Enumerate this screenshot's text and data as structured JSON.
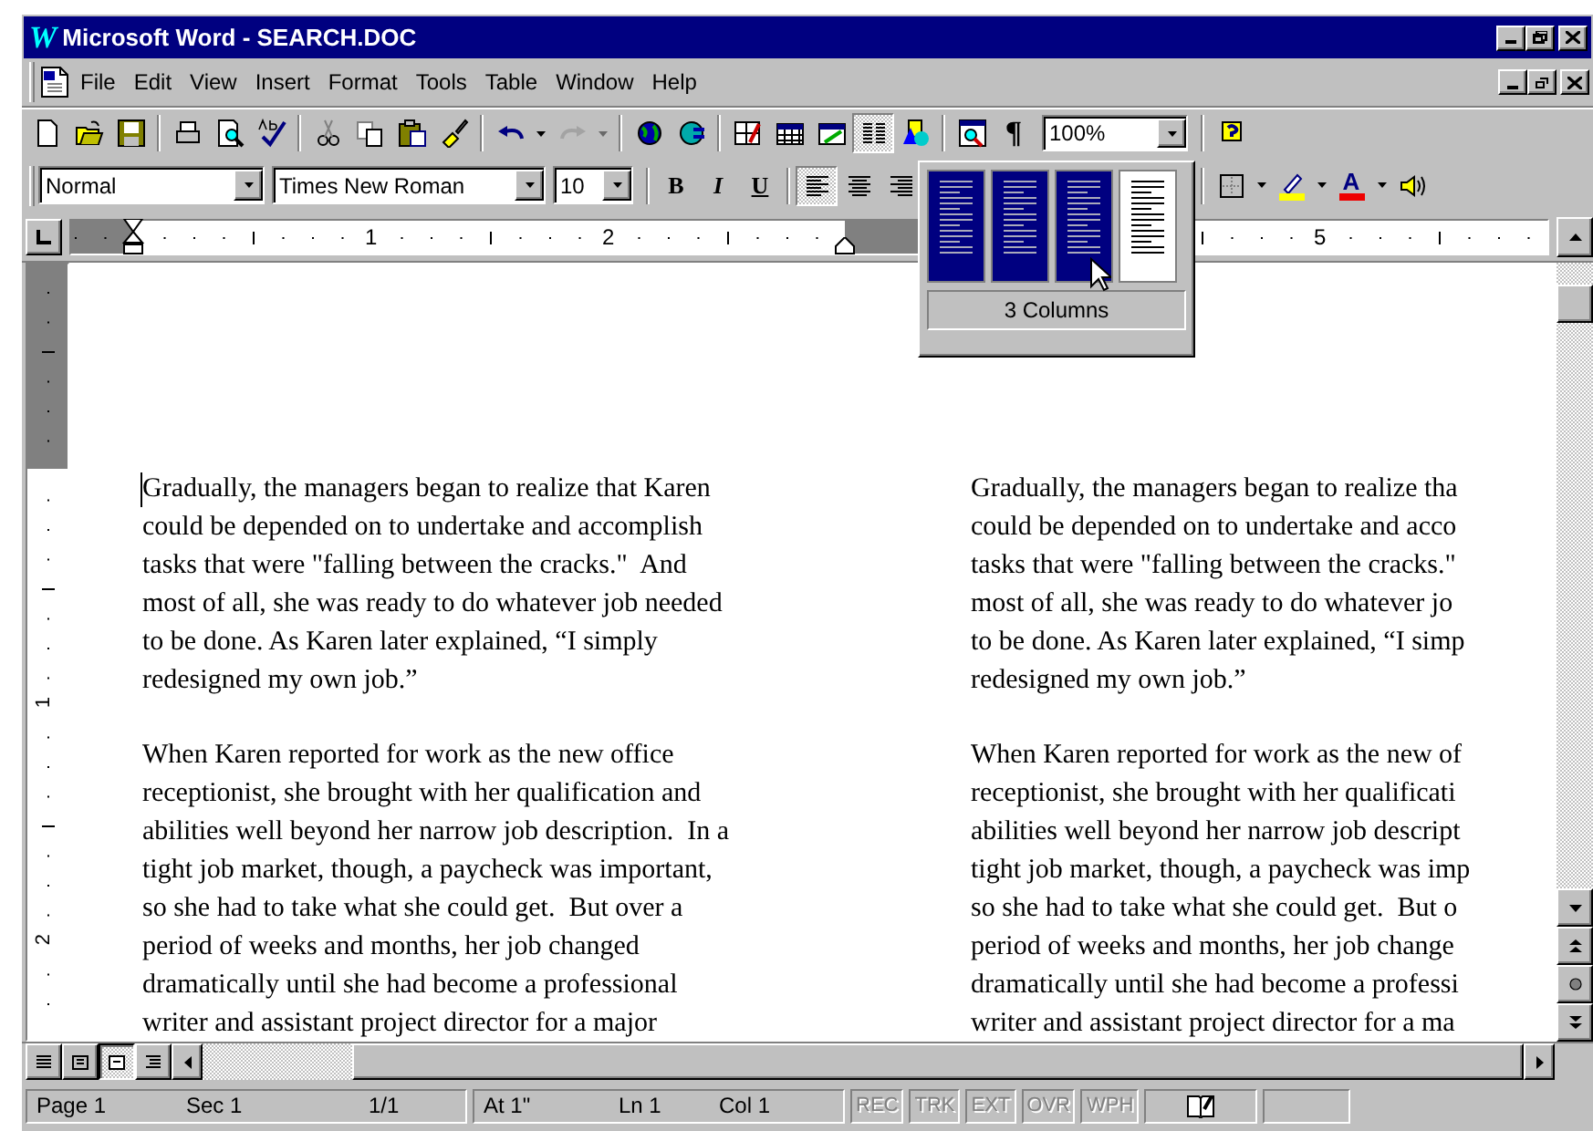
{
  "window": {
    "logo": "W",
    "title": "Microsoft Word - SEARCH.DOC"
  },
  "menu_bar": {
    "items": [
      "File",
      "Edit",
      "View",
      "Insert",
      "Format",
      "Tools",
      "Table",
      "Window",
      "Help"
    ]
  },
  "standard_toolbar": {
    "columns_pressed": true,
    "redo_disabled": true,
    "pilcrow": "¶",
    "zoom": "100%"
  },
  "formatting_toolbar": {
    "style": "Normal",
    "font": "Times New Roman",
    "size": "10",
    "text_buttons": [
      {
        "label": "B",
        "kind": "bold"
      },
      {
        "label": "I",
        "kind": "italic"
      },
      {
        "label": "U",
        "kind": "underline"
      }
    ],
    "align_left_pressed": true,
    "font_color_letter": "A"
  },
  "columns_picker": {
    "label": "3 Columns",
    "options": [
      {
        "selected": true
      },
      {
        "selected": true
      },
      {
        "selected": true
      },
      {
        "selected": false
      }
    ]
  },
  "ruler": {
    "numbers": [
      "1",
      "2",
      "5"
    ]
  },
  "vertical_ruler": {
    "numbers": [
      "1",
      "2"
    ]
  },
  "document": {
    "columns": [
      {
        "paragraphs": [
          [
            "Gradually, the managers began to realize that Karen",
            "could be depended on to undertake and accomplish",
            "tasks that were \"falling between the cracks.\"  And",
            "most of all, she was ready to do whatever job needed",
            "to be done. As Karen later explained, “I simply",
            "redesigned my own job.”"
          ],
          [
            "When Karen reported for work as the new office",
            "receptionist, she brought with her qualification and",
            "abilities well beyond her narrow job description.  In a",
            "tight job market, though, a paycheck was important,",
            "so she had to take what she could get.  But over a",
            "period of weeks and months, her job changed",
            "dramatically until she had become a professional",
            "writer and assistant project director for a major"
          ]
        ]
      },
      {
        "paragraphs": [
          [
            "Gradually, the managers began to realize tha",
            "could be depended on to undertake and acco",
            "tasks that were \"falling between the cracks.\"",
            "most of all, she was ready to do whatever jo",
            "to be done. As Karen later explained, “I simp",
            "redesigned my own job.”"
          ],
          [
            "When Karen reported for work as the new of",
            "receptionist, she brought with her qualificati",
            "abilities well beyond her narrow job descript",
            "tight job market, though, a paycheck was imp",
            "so she had to take what she could get.  But o",
            "period of weeks and months, her job change",
            "dramatically until she had become a professi",
            "writer and assistant project director for a ma"
          ]
        ]
      }
    ]
  },
  "view_buttons": [
    {
      "selected": false
    },
    {
      "selected": false
    },
    {
      "selected": true
    },
    {
      "selected": false
    }
  ],
  "status_bar": {
    "position": [
      "Page 1",
      "Sec 1",
      "1/1"
    ],
    "cursor": [
      "At 1\"",
      "Ln 1",
      "Col 1"
    ],
    "modes": [
      {
        "label": "REC",
        "disabled": true
      },
      {
        "label": "TRK",
        "disabled": true
      },
      {
        "label": "EXT",
        "disabled": true
      },
      {
        "label": "OVR",
        "disabled": true
      },
      {
        "label": "WPH",
        "disabled": true
      }
    ]
  }
}
